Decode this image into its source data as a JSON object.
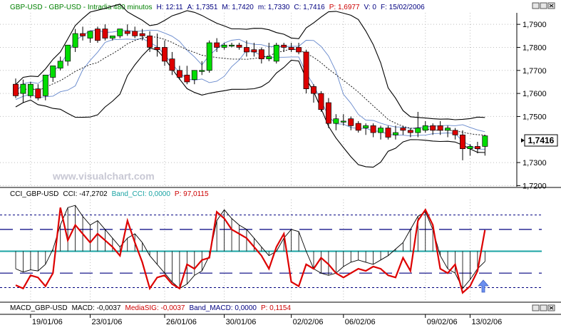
{
  "price_header": [
    {
      "text": "GBP-USD - GBP-USD - Intradia 480 minutos",
      "color": "#008000"
    },
    {
      "text": "H: 12:11",
      "color": "#000080"
    },
    {
      "text": "A: 1,7351",
      "color": "#000080"
    },
    {
      "text": "M: 1,7420",
      "color": "#000080"
    },
    {
      "text": "m: 1,7330",
      "color": "#000080"
    },
    {
      "text": "C: 1,7416",
      "color": "#000080"
    },
    {
      "text": "P: 1,6977",
      "color": "#cc0000"
    },
    {
      "text": "V: 0",
      "color": "#000080"
    },
    {
      "text": "F: 15/02/2006",
      "color": "#000080"
    }
  ],
  "cci_header": [
    {
      "text": "CCI_GBP-USD",
      "color": "#000000"
    },
    {
      "text": "CCI: -47,2702",
      "color": "#000000"
    },
    {
      "text": "Band_CCI: 0,0000",
      "color": "#1aa3a3"
    },
    {
      "text": "P: 97,0115",
      "color": "#cc0000"
    }
  ],
  "macd_header": [
    {
      "text": "MACD_GBP-USD",
      "color": "#000000"
    },
    {
      "text": "MACD: -0,0037",
      "color": "#000000"
    },
    {
      "text": "MediaSIG: -0,0037",
      "color": "#cc0000"
    },
    {
      "text": "Band_MACD: 0,0000",
      "color": "#000080"
    },
    {
      "text": "P: 0,1154",
      "color": "#cc0000"
    }
  ],
  "watermark": "www.visualchart.com",
  "last_price_tag": "1,7416",
  "colors": {
    "up": "#00dd00",
    "down": "#dd0000",
    "cci_line": "#dd0000",
    "band_line": "#1aa3a3",
    "dashed_band": "#000080",
    "envelope": "#000000",
    "inner_band": "#6688cc"
  },
  "chart_data": [
    {
      "type": "candlestick",
      "title": "GBP-USD - GBP-USD - Intradia 480 minutos",
      "y_ticks": [
        "1,7900",
        "1,7800",
        "1,7700",
        "1,7600",
        "1,7500",
        "1,7300",
        "1,7200"
      ],
      "ylim": [
        1.7195,
        1.795
      ],
      "candles": [
        {
          "o": 1.764,
          "h": 1.7665,
          "l": 1.758,
          "c": 1.759
        },
        {
          "o": 1.76,
          "h": 1.766,
          "l": 1.756,
          "c": 1.764
        },
        {
          "o": 1.759,
          "h": 1.765,
          "l": 1.758,
          "c": 1.764
        },
        {
          "o": 1.762,
          "h": 1.764,
          "l": 1.757,
          "c": 1.758
        },
        {
          "o": 1.759,
          "h": 1.768,
          "l": 1.757,
          "c": 1.768
        },
        {
          "o": 1.767,
          "h": 1.772,
          "l": 1.765,
          "c": 1.772
        },
        {
          "o": 1.771,
          "h": 1.776,
          "l": 1.77,
          "c": 1.774
        },
        {
          "o": 1.774,
          "h": 1.781,
          "l": 1.772,
          "c": 1.781
        },
        {
          "o": 1.78,
          "h": 1.788,
          "l": 1.778,
          "c": 1.786
        },
        {
          "o": 1.786,
          "h": 1.789,
          "l": 1.783,
          "c": 1.785
        },
        {
          "o": 1.784,
          "h": 1.787,
          "l": 1.782,
          "c": 1.787
        },
        {
          "o": 1.788,
          "h": 1.789,
          "l": 1.782,
          "c": 1.783
        },
        {
          "o": 1.788,
          "h": 1.79,
          "l": 1.783,
          "c": 1.784
        },
        {
          "o": 1.784,
          "h": 1.785,
          "l": 1.783,
          "c": 1.785
        },
        {
          "o": 1.785,
          "h": 1.788,
          "l": 1.784,
          "c": 1.788
        },
        {
          "o": 1.787,
          "h": 1.79,
          "l": 1.785,
          "c": 1.786
        },
        {
          "o": 1.787,
          "h": 1.789,
          "l": 1.784,
          "c": 1.785
        },
        {
          "o": 1.786,
          "h": 1.788,
          "l": 1.783,
          "c": 1.785
        },
        {
          "o": 1.785,
          "h": 1.787,
          "l": 1.778,
          "c": 1.78
        },
        {
          "o": 1.78,
          "h": 1.786,
          "l": 1.776,
          "c": 1.779
        },
        {
          "o": 1.78,
          "h": 1.783,
          "l": 1.772,
          "c": 1.774
        },
        {
          "o": 1.775,
          "h": 1.778,
          "l": 1.768,
          "c": 1.77
        },
        {
          "o": 1.77,
          "h": 1.772,
          "l": 1.766,
          "c": 1.767
        },
        {
          "o": 1.768,
          "h": 1.772,
          "l": 1.764,
          "c": 1.765
        },
        {
          "o": 1.766,
          "h": 1.77,
          "l": 1.764,
          "c": 1.77
        },
        {
          "o": 1.77,
          "h": 1.774,
          "l": 1.768,
          "c": 1.77
        },
        {
          "o": 1.77,
          "h": 1.783,
          "l": 1.769,
          "c": 1.782
        },
        {
          "o": 1.782,
          "h": 1.784,
          "l": 1.778,
          "c": 1.78
        },
        {
          "o": 1.78,
          "h": 1.782,
          "l": 1.779,
          "c": 1.781
        },
        {
          "o": 1.781,
          "h": 1.782,
          "l": 1.78,
          "c": 1.781
        },
        {
          "o": 1.781,
          "h": 1.782,
          "l": 1.779,
          "c": 1.78
        },
        {
          "o": 1.78,
          "h": 1.783,
          "l": 1.776,
          "c": 1.778
        },
        {
          "o": 1.779,
          "h": 1.782,
          "l": 1.776,
          "c": 1.778
        },
        {
          "o": 1.779,
          "h": 1.78,
          "l": 1.773,
          "c": 1.775
        },
        {
          "o": 1.775,
          "h": 1.782,
          "l": 1.774,
          "c": 1.776
        },
        {
          "o": 1.774,
          "h": 1.782,
          "l": 1.773,
          "c": 1.781
        },
        {
          "o": 1.781,
          "h": 1.782,
          "l": 1.778,
          "c": 1.78
        },
        {
          "o": 1.78,
          "h": 1.782,
          "l": 1.778,
          "c": 1.779
        },
        {
          "o": 1.78,
          "h": 1.782,
          "l": 1.777,
          "c": 1.778
        },
        {
          "o": 1.778,
          "h": 1.779,
          "l": 1.76,
          "c": 1.762
        },
        {
          "o": 1.763,
          "h": 1.764,
          "l": 1.756,
          "c": 1.76
        },
        {
          "o": 1.76,
          "h": 1.761,
          "l": 1.752,
          "c": 1.753
        },
        {
          "o": 1.756,
          "h": 1.758,
          "l": 1.745,
          "c": 1.747
        },
        {
          "o": 1.747,
          "h": 1.751,
          "l": 1.744,
          "c": 1.749
        },
        {
          "o": 1.748,
          "h": 1.751,
          "l": 1.746,
          "c": 1.748
        },
        {
          "o": 1.749,
          "h": 1.75,
          "l": 1.744,
          "c": 1.746
        },
        {
          "o": 1.747,
          "h": 1.748,
          "l": 1.743,
          "c": 1.744
        },
        {
          "o": 1.745,
          "h": 1.747,
          "l": 1.742,
          "c": 1.746
        },
        {
          "o": 1.746,
          "h": 1.747,
          "l": 1.741,
          "c": 1.743
        },
        {
          "o": 1.743,
          "h": 1.746,
          "l": 1.74,
          "c": 1.745
        },
        {
          "o": 1.745,
          "h": 1.746,
          "l": 1.74,
          "c": 1.741
        },
        {
          "o": 1.742,
          "h": 1.746,
          "l": 1.74,
          "c": 1.743
        },
        {
          "o": 1.745,
          "h": 1.746,
          "l": 1.742,
          "c": 1.744
        },
        {
          "o": 1.744,
          "h": 1.745,
          "l": 1.741,
          "c": 1.743
        },
        {
          "o": 1.743,
          "h": 1.752,
          "l": 1.741,
          "c": 1.745
        },
        {
          "o": 1.744,
          "h": 1.748,
          "l": 1.743,
          "c": 1.746
        },
        {
          "o": 1.746,
          "h": 1.747,
          "l": 1.742,
          "c": 1.744
        },
        {
          "o": 1.746,
          "h": 1.748,
          "l": 1.742,
          "c": 1.744
        },
        {
          "o": 1.744,
          "h": 1.746,
          "l": 1.741,
          "c": 1.745
        },
        {
          "o": 1.744,
          "h": 1.745,
          "l": 1.74,
          "c": 1.742
        },
        {
          "o": 1.742,
          "h": 1.744,
          "l": 1.731,
          "c": 1.736
        },
        {
          "o": 1.736,
          "h": 1.738,
          "l": 1.733,
          "c": 1.737
        },
        {
          "o": 1.737,
          "h": 1.739,
          "l": 1.734,
          "c": 1.736
        },
        {
          "o": 1.737,
          "h": 1.742,
          "l": 1.733,
          "c": 1.7416
        }
      ],
      "last_price": 1.7416
    },
    {
      "type": "line",
      "title": "CCI_GBP-USD",
      "series": [
        {
          "name": "CCI",
          "values": [
            -80,
            -95,
            -85,
            -90,
            -60,
            10,
            120,
            200,
            210,
            160,
            120,
            140,
            100,
            60,
            20,
            60,
            80,
            40,
            -20,
            -60,
            -100,
            -140,
            -170,
            -150,
            -110,
            -90,
            -20,
            140,
            190,
            150,
            120,
            100,
            60,
            20,
            -20,
            0,
            60,
            100,
            90,
            0,
            -80,
            -100,
            -110,
            -100,
            -70,
            -50,
            -40,
            -50,
            -60,
            -40,
            -20,
            10,
            40,
            100,
            160,
            180,
            100,
            -20,
            -80,
            -100,
            -170,
            -130,
            -80,
            -47
          ]
        },
        {
          "name": "P",
          "values": [
            -155,
            -170,
            -110,
            -120,
            -160,
            -100,
            200,
            50,
            120,
            80,
            40,
            80,
            50,
            20,
            -20,
            140,
            40,
            -50,
            -170,
            -120,
            -110,
            -150,
            -170,
            -60,
            -80,
            -40,
            -30,
            180,
            150,
            100,
            80,
            60,
            20,
            -20,
            -80,
            20,
            80,
            -140,
            -160,
            -60,
            -80,
            -30,
            -60,
            -100,
            -120,
            -100,
            -80,
            -90,
            -70,
            -80,
            -110,
            -120,
            -30,
            -90,
            140,
            190,
            120,
            -80,
            -100,
            -60,
            -190,
            -160,
            -90,
            97
          ]
        },
        {
          "name": "Band_CCI",
          "values": [
            0
          ]
        }
      ],
      "reference_levels": [
        -166,
        -100,
        0,
        100,
        166
      ]
    },
    {
      "type": "line",
      "title": "MACD_GBP-USD",
      "series": [],
      "x_ticks": [
        "19/01/06",
        "23/01/06",
        "26/01/06",
        "30/01/06",
        "02/02/06",
        "06/02/06",
        "09/02/06",
        "13/02/06"
      ]
    }
  ]
}
